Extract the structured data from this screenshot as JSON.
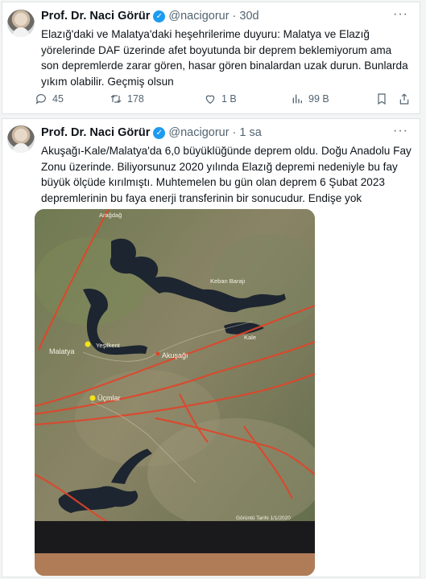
{
  "tweets": [
    {
      "name": "Prof. Dr. Naci Görür",
      "verified_mark": "✓",
      "handle": "@nacigorur",
      "separator": "·",
      "time": "30d",
      "more": "···",
      "text": "Elazığ'daki ve Malatya'daki heşehrilerime duyuru: Malatya ve Elazığ yörelerinde DAF üzerinde afet boyutunda bir deprem beklemiyorum ama son depremlerde zarar gören, hasar gören binalardan uzak durun. Bunlarda yıkım olabilir. Geçmiş olsun",
      "stats": {
        "replies": "45",
        "retweets": "178",
        "likes": "1 B",
        "views": "99 B"
      }
    },
    {
      "name": "Prof. Dr. Naci Görür",
      "verified_mark": "✓",
      "handle": "@nacigorur",
      "separator": "·",
      "time": "1 sa",
      "more": "···",
      "text": "Akuşağı-Kale/Malatya'da 6,0 büyüklüğünde deprem oldu. Doğu Anadolu Fay Zonu üzerinde. Biliyorsunuz 2020 yılında Elazığ depremi nedeniyle bu fay büyük ölçüde kırılmıştı. Muhtemelen bu gün olan deprem 6 Şubat 2023 depremlerinin bu faya enerji transferinin bir sonucudur. Endişe yok"
    }
  ],
  "map": {
    "labels": {
      "aradag": "Arağdağ",
      "keban_baraji": "Keban Barajı",
      "akusagi": "Akuşağı",
      "malatya": "Malatya",
      "yesilkent": "Yeşilkent",
      "kale": "Kale",
      "ucmlar": "Üçmlar",
      "imagery_date": "Görüntü Tarihi 1/1/2020"
    },
    "colors": {
      "fault": "#e0452a",
      "water": "#1d2530",
      "pin": "#f3e318"
    }
  }
}
